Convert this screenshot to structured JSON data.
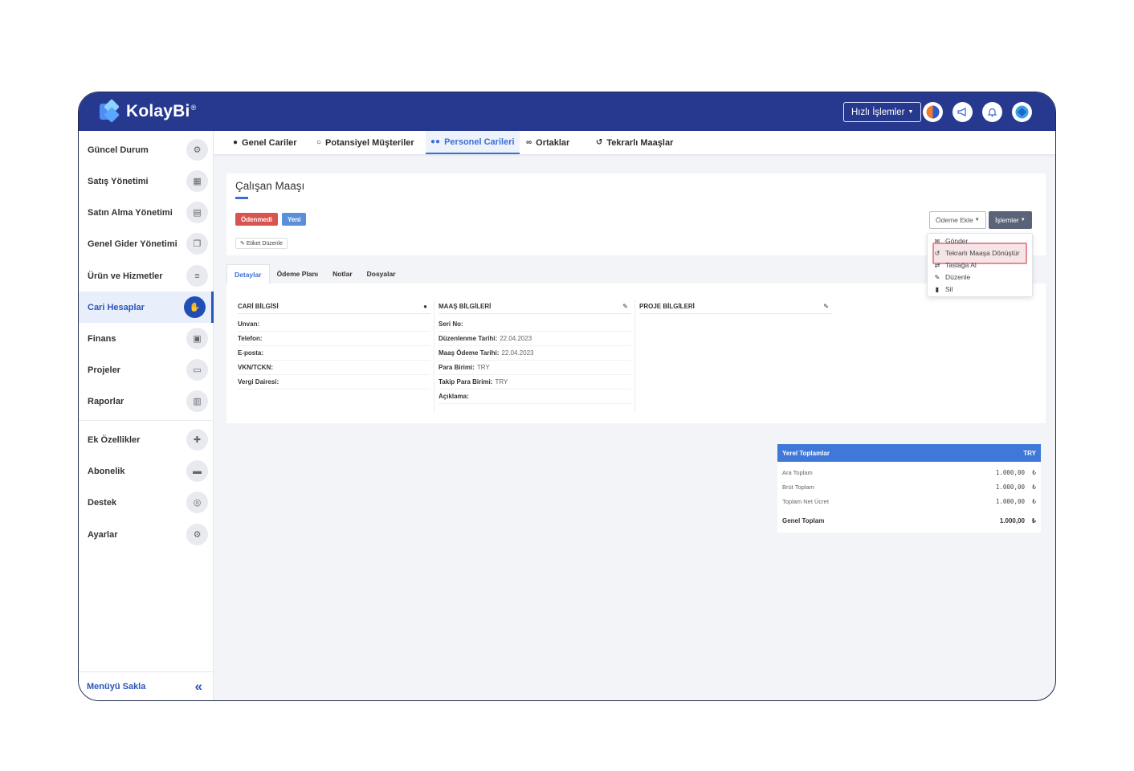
{
  "brand": {
    "name": "KolayBi",
    "reg": "®"
  },
  "topbar": {
    "quick_actions": "Hızlı İşlemler",
    "icons": [
      "app-logo-icon",
      "megaphone-icon",
      "bell-icon",
      "globe-icon"
    ]
  },
  "sidebar": {
    "items": [
      {
        "label": "Güncel Durum",
        "icon": "dashboard-icon",
        "glyph": "⚙"
      },
      {
        "label": "Satış Yönetimi",
        "icon": "calculator-icon",
        "glyph": "▦"
      },
      {
        "label": "Satın Alma Yönetimi",
        "icon": "document-icon",
        "glyph": "▤"
      },
      {
        "label": "Genel Gider Yönetimi",
        "icon": "copy-icon",
        "glyph": "❐"
      },
      {
        "label": "Ürün ve Hizmetler",
        "icon": "database-icon",
        "glyph": "≡"
      },
      {
        "label": "Cari Hesaplar",
        "icon": "handshake-icon",
        "glyph": "✋"
      },
      {
        "label": "Finans",
        "icon": "money-icon",
        "glyph": "▣"
      },
      {
        "label": "Projeler",
        "icon": "folder-icon",
        "glyph": "▭"
      },
      {
        "label": "Raporlar",
        "icon": "bar-chart-icon",
        "glyph": "▥"
      },
      {
        "label": "Ek Özellikler",
        "icon": "puzzle-icon",
        "glyph": "✚"
      },
      {
        "label": "Abonelik",
        "icon": "credit-card-icon",
        "glyph": "▬"
      },
      {
        "label": "Destek",
        "icon": "lifebuoy-icon",
        "glyph": "◎"
      },
      {
        "label": "Ayarlar",
        "icon": "settings-icon",
        "glyph": "⚙"
      }
    ],
    "active_index": 5,
    "hide_menu": "Menüyü Sakla"
  },
  "tabs": [
    {
      "label": "Genel Cariler",
      "icon": "user-icon",
      "glyph": "👤"
    },
    {
      "label": "Potansiyel Müşteriler",
      "icon": "user-outline-icon",
      "glyph": "♙"
    },
    {
      "label": "Personel Carileri",
      "icon": "users-icon",
      "glyph": "👥"
    },
    {
      "label": "Ortaklar",
      "icon": "handshake-icon",
      "glyph": "∞"
    },
    {
      "label": "Tekrarlı Maaşlar",
      "icon": "repeat-icon",
      "glyph": "↺"
    }
  ],
  "active_tab": 2,
  "page": {
    "title": "Çalışan Maaşı",
    "badges": [
      {
        "label": "Ödenmedi",
        "color": "#d9534f"
      },
      {
        "label": "Yeni",
        "color": "#5b8fd9"
      }
    ],
    "tag_edit": "Etiket Düzenle",
    "add_payment": "Ödeme Ekle",
    "actions": "İşlemler"
  },
  "actions_menu": [
    {
      "label": "Gönder",
      "icon": "envelope-icon",
      "glyph": "✉"
    },
    {
      "label": "Tekrarlı Maaşa Dönüştür",
      "icon": "repeat-icon",
      "glyph": "↺"
    },
    {
      "label": "Taslağa Al",
      "icon": "draft-icon",
      "glyph": "⇄"
    },
    {
      "label": "Düzenle",
      "icon": "pencil-icon",
      "glyph": "✎"
    },
    {
      "label": "Sil",
      "icon": "trash-icon",
      "glyph": "🗑"
    }
  ],
  "subtabs": [
    "Detaylar",
    "Ödeme Planı",
    "Notlar",
    "Dosyalar"
  ],
  "cari_bilgisi": {
    "title": "CARİ BİLGİSİ",
    "fields": [
      {
        "label": "Unvan:",
        "value": ""
      },
      {
        "label": "Telefon:",
        "value": ""
      },
      {
        "label": "E-posta:",
        "value": ""
      },
      {
        "label": "VKN/TCKN:",
        "value": ""
      },
      {
        "label": "Vergi Dairesi:",
        "value": ""
      }
    ]
  },
  "maas_bilgileri": {
    "title": "MAAŞ BİLGİLERİ",
    "fields": [
      {
        "label": "Seri No:",
        "value": ""
      },
      {
        "label": "Düzenlenme Tarihi:",
        "value": "22.04.2023"
      },
      {
        "label": "Maaş Ödeme Tarihi:",
        "value": "22.04.2023"
      },
      {
        "label": "Para Birimi:",
        "value": "TRY"
      },
      {
        "label": "Takip Para Birimi:",
        "value": "TRY"
      },
      {
        "label": "Açıklama:",
        "value": ""
      }
    ]
  },
  "proje_bilgileri": {
    "title": "PROJE BİLGİLERİ"
  },
  "totals": {
    "title": "Yerel Toplamlar",
    "currency": "TRY",
    "rows": [
      {
        "label": "Ara Toplam",
        "value": "1.000,00",
        "symbol": "₺"
      },
      {
        "label": "Brüt Toplam",
        "value": "1.000,00",
        "symbol": "₺"
      },
      {
        "label": "Toplam Net Ücret",
        "value": "1.000,00",
        "symbol": "₺"
      }
    ],
    "grand": {
      "label": "Genel Toplam",
      "value": "1.000,00",
      "symbol": "₺"
    }
  }
}
